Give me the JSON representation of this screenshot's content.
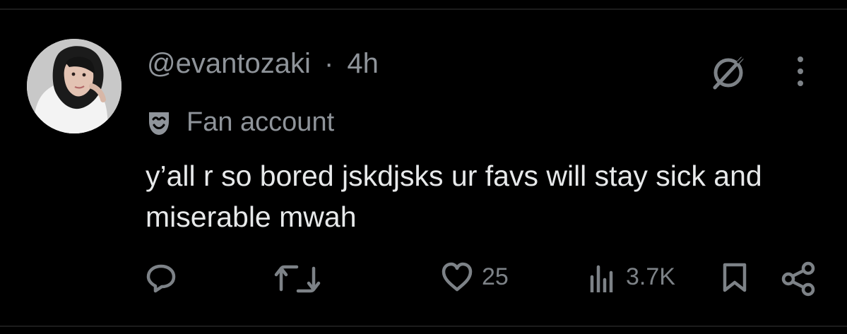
{
  "post": {
    "handle": "@evantozaki",
    "separator": "·",
    "time": "4h",
    "badge_label": "Fan account",
    "text": "y’all r so bored jskdjsks ur favs will stay sick and miserable mwah"
  },
  "actions": {
    "like_count": "25",
    "view_count": "3.7K"
  },
  "icons": {
    "avatar": "avatar",
    "badge": "drama-mask-icon",
    "grok": "grok-icon",
    "more": "more-vertical-icon",
    "reply": "reply-icon",
    "repost": "repost-icon",
    "like": "heart-icon",
    "views": "views-chart-icon",
    "bookmark": "bookmark-icon",
    "share": "share-icon"
  },
  "colors": {
    "background": "#000000",
    "primary_text": "#e7e9ea",
    "secondary_text": "#8f949a",
    "icon_gray": "#7d8287"
  }
}
